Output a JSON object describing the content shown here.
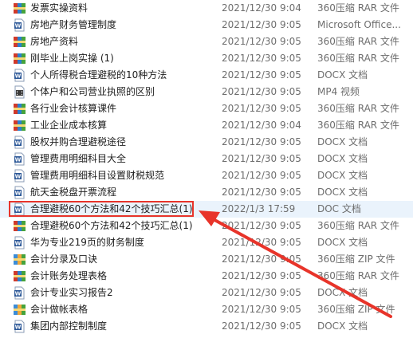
{
  "files": [
    {
      "name": "发票实操资料",
      "date": "2021/12/30 9:04",
      "type": "360压缩 RAR 文件",
      "icon": "rar-archive-icon"
    },
    {
      "name": "房地产财务管理制度",
      "date": "2021/12/30 9:05",
      "type": "Microsoft Office...",
      "icon": "word-document-icon"
    },
    {
      "name": "房地产资料",
      "date": "2021/12/30 9:05",
      "type": "360压缩 RAR 文件",
      "icon": "rar-archive-icon"
    },
    {
      "name": "刚毕业上岗实操 (1)",
      "date": "2021/12/30 9:05",
      "type": "360压缩 RAR 文件",
      "icon": "rar-archive-icon"
    },
    {
      "name": "个人所得税合理避税的10种方法",
      "date": "2021/12/30 9:05",
      "type": "DOCX 文档",
      "icon": "word-document-icon"
    },
    {
      "name": "个体户和公司营业执照的区别",
      "date": "2021/12/30 9:05",
      "type": "MP4 视频",
      "icon": "video-file-icon"
    },
    {
      "name": "各行业会计核算课件",
      "date": "2021/12/30 9:05",
      "type": "360压缩 RAR 文件",
      "icon": "rar-archive-icon"
    },
    {
      "name": "工业企业成本核算",
      "date": "2021/12/30 9:04",
      "type": "360压缩 RAR 文件",
      "icon": "rar-archive-icon"
    },
    {
      "name": "股权并购合理避税途径",
      "date": "2021/12/30 9:05",
      "type": "DOCX 文档",
      "icon": "word-document-icon"
    },
    {
      "name": "管理费用明细科目大全",
      "date": "2021/12/30 9:05",
      "type": "DOCX 文档",
      "icon": "word-document-icon"
    },
    {
      "name": "管理费用明细科目设置财税规范",
      "date": "2021/12/30 9:05",
      "type": "DOCX 文档",
      "icon": "word-document-icon"
    },
    {
      "name": "航天金税盘开票流程",
      "date": "2021/12/30 9:05",
      "type": "DOCX 文档",
      "icon": "word-document-icon"
    },
    {
      "name": "合理避税60个方法和42个技巧汇总(1)",
      "date": "2022/1/3 17:59",
      "type": "DOC 文档",
      "icon": "word-document-icon"
    },
    {
      "name": "合理避税60个方法和42个技巧汇总(1)",
      "date": "2021/12/30 9:05",
      "type": "360压缩 RAR 文件",
      "icon": "rar-archive-icon"
    },
    {
      "name": "华为专业219页的财务制度",
      "date": "2021/12/30 9:05",
      "type": "DOCX 文档",
      "icon": "word-document-icon"
    },
    {
      "name": "会计分录及口诀",
      "date": "2021/12/30 9:05",
      "type": "360压缩 ZIP 文件",
      "icon": "zip-archive-icon"
    },
    {
      "name": "会计账务处理表格",
      "date": "2021/12/30 9:05",
      "type": "360压缩 RAR 文件",
      "icon": "rar-archive-icon"
    },
    {
      "name": "会计专业实习报告2",
      "date": "2021/12/30 9:05",
      "type": "DOCX 文档",
      "icon": "word-document-icon"
    },
    {
      "name": "会计做帐表格",
      "date": "2021/12/30 9:05",
      "type": "360压缩 ZIP 文件",
      "icon": "zip-archive-icon"
    },
    {
      "name": "集团内部控制制度",
      "date": "2021/12/30 9:05",
      "type": "DOCX 文档",
      "icon": "word-document-icon"
    }
  ],
  "highlighted_file": "合理避税60个方法和42个技巧汇总(1)",
  "colors": {
    "highlight": "#e8342a",
    "arrow": "#e8342a",
    "text": "#1e1e1e",
    "meta_text": "#6d6d6d"
  }
}
